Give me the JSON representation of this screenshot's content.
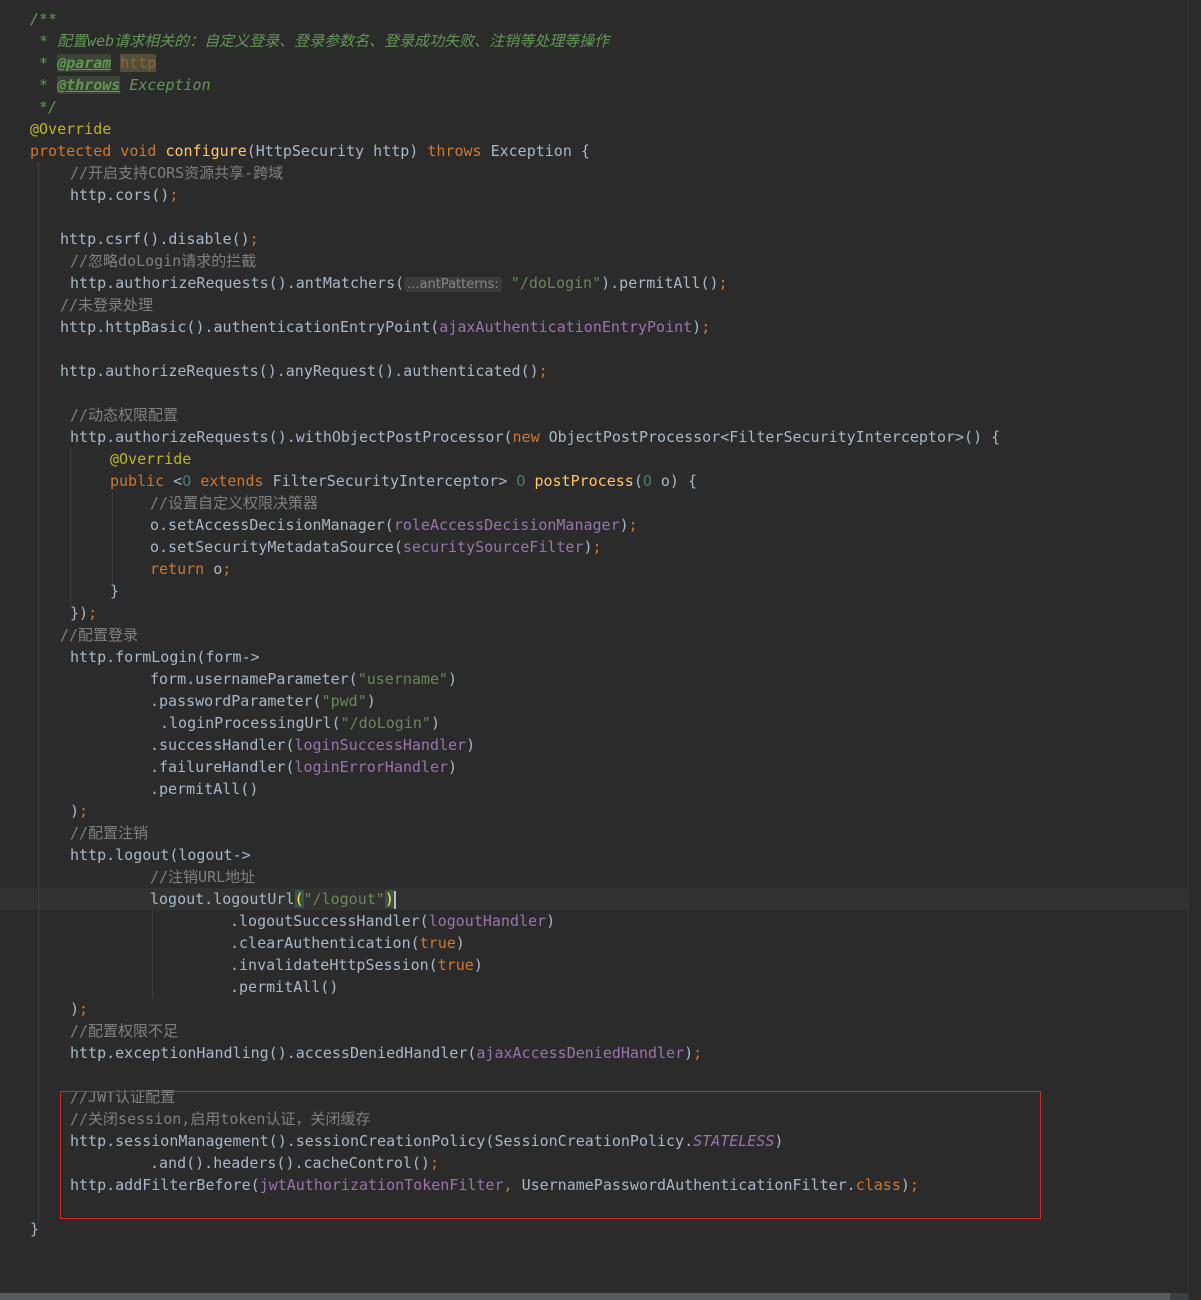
{
  "editor": {
    "language": "java",
    "lines": [
      {
        "indent": 30,
        "tokens": [
          {
            "t": "/**",
            "c": "doc"
          }
        ]
      },
      {
        "indent": 30,
        "tokens": [
          {
            "t": " * 配置web请求相关的：自定义登录、登录参数名、登录成功失败、注销等处理等操作",
            "c": "doc"
          }
        ]
      },
      {
        "indent": 30,
        "tokens": [
          {
            "t": " * ",
            "c": "doc"
          },
          {
            "t": "@param",
            "c": "doctag"
          },
          {
            "t": " ",
            "c": "doc"
          },
          {
            "t": "http",
            "c": "docparam"
          }
        ]
      },
      {
        "indent": 30,
        "tokens": [
          {
            "t": " * ",
            "c": "doc"
          },
          {
            "t": "@throws",
            "c": "doctag"
          },
          {
            "t": " Exception",
            "c": "doc"
          }
        ]
      },
      {
        "indent": 30,
        "tokens": [
          {
            "t": " */",
            "c": "doc"
          }
        ]
      },
      {
        "indent": 30,
        "tokens": [
          {
            "t": "@Override",
            "c": "ann"
          }
        ]
      },
      {
        "indent": 30,
        "tokens": [
          {
            "t": "protected void ",
            "c": "kw"
          },
          {
            "t": "configure",
            "c": "fn"
          },
          {
            "t": "(HttpSecurity http) ",
            "c": "def"
          },
          {
            "t": "throws ",
            "c": "kw"
          },
          {
            "t": "Exception {",
            "c": "def"
          }
        ]
      },
      {
        "indent": 70,
        "tokens": [
          {
            "t": "//开启支持CORS资源共享-跨域",
            "c": "cmt"
          }
        ]
      },
      {
        "indent": 70,
        "tokens": [
          {
            "t": "http.cors()",
            "c": "def"
          },
          {
            "t": ";",
            "c": "kw"
          }
        ]
      },
      {
        "indent": 70,
        "tokens": []
      },
      {
        "indent": 60,
        "tokens": [
          {
            "t": "http.csrf().disable()",
            "c": "def"
          },
          {
            "t": ";",
            "c": "kw"
          }
        ]
      },
      {
        "indent": 70,
        "tokens": [
          {
            "t": "//忽略doLogin请求的拦截",
            "c": "cmt"
          }
        ]
      },
      {
        "indent": 70,
        "tokens": [
          {
            "t": "http.authorizeRequests().antMatchers(",
            "c": "def"
          },
          {
            "t": "...antPatterns:",
            "c": "hint"
          },
          {
            "t": " ",
            "c": "def"
          },
          {
            "t": "\"/doLogin\"",
            "c": "str"
          },
          {
            "t": ").permitAll()",
            "c": "def"
          },
          {
            "t": ";",
            "c": "kw"
          }
        ]
      },
      {
        "indent": 60,
        "tokens": [
          {
            "t": "//未登录处理",
            "c": "cmt"
          }
        ]
      },
      {
        "indent": 60,
        "tokens": [
          {
            "t": "http.httpBasic().authenticationEntryPoint(",
            "c": "def"
          },
          {
            "t": "ajaxAuthenticationEntryPoint",
            "c": "fld"
          },
          {
            "t": ")",
            "c": "def"
          },
          {
            "t": ";",
            "c": "kw"
          }
        ]
      },
      {
        "indent": 60,
        "tokens": []
      },
      {
        "indent": 60,
        "tokens": [
          {
            "t": "http.authorizeRequests().anyRequest().authenticated()",
            "c": "def"
          },
          {
            "t": ";",
            "c": "kw"
          }
        ]
      },
      {
        "indent": 60,
        "tokens": []
      },
      {
        "indent": 70,
        "tokens": [
          {
            "t": "//动态权限配置",
            "c": "cmt"
          }
        ]
      },
      {
        "indent": 70,
        "tokens": [
          {
            "t": "http.authorizeRequests().withObjectPostProcessor(",
            "c": "def"
          },
          {
            "t": "new ",
            "c": "kw"
          },
          {
            "t": "ObjectPostProcessor<FilterSecurityInterceptor>() {",
            "c": "def"
          }
        ]
      },
      {
        "indent": 110,
        "tokens": [
          {
            "t": "@Override",
            "c": "ann"
          }
        ]
      },
      {
        "indent": 110,
        "tokens": [
          {
            "t": "public ",
            "c": "kw"
          },
          {
            "t": "<",
            "c": "def"
          },
          {
            "t": "O ",
            "c": "typp"
          },
          {
            "t": "extends ",
            "c": "kw"
          },
          {
            "t": "FilterSecurityInterceptor> ",
            "c": "def"
          },
          {
            "t": "O ",
            "c": "typp"
          },
          {
            "t": "postProcess",
            "c": "fn"
          },
          {
            "t": "(",
            "c": "def"
          },
          {
            "t": "O ",
            "c": "typp"
          },
          {
            "t": "o) {",
            "c": "def"
          }
        ]
      },
      {
        "indent": 150,
        "tokens": [
          {
            "t": "//设置自定义权限决策器",
            "c": "cmt"
          }
        ]
      },
      {
        "indent": 150,
        "tokens": [
          {
            "t": "o.setAccessDecisionManager(",
            "c": "def"
          },
          {
            "t": "roleAccessDecisionManager",
            "c": "fld"
          },
          {
            "t": ")",
            "c": "def"
          },
          {
            "t": ";",
            "c": "kw"
          }
        ]
      },
      {
        "indent": 150,
        "tokens": [
          {
            "t": "o.setSecurityMetadataSource(",
            "c": "def"
          },
          {
            "t": "securitySourceFilter",
            "c": "fld"
          },
          {
            "t": ")",
            "c": "def"
          },
          {
            "t": ";",
            "c": "kw"
          }
        ]
      },
      {
        "indent": 150,
        "tokens": [
          {
            "t": "return ",
            "c": "kw"
          },
          {
            "t": "o",
            "c": "def"
          },
          {
            "t": ";",
            "c": "kw"
          }
        ]
      },
      {
        "indent": 110,
        "tokens": [
          {
            "t": "}",
            "c": "def"
          }
        ]
      },
      {
        "indent": 70,
        "tokens": [
          {
            "t": "})",
            "c": "def"
          },
          {
            "t": ";",
            "c": "kw"
          }
        ]
      },
      {
        "indent": 60,
        "tokens": [
          {
            "t": "//配置登录",
            "c": "cmt"
          }
        ]
      },
      {
        "indent": 70,
        "tokens": [
          {
            "t": "http.formLogin(form->",
            "c": "def"
          }
        ]
      },
      {
        "indent": 150,
        "tokens": [
          {
            "t": "form.usernameParameter(",
            "c": "def"
          },
          {
            "t": "\"username\"",
            "c": "str"
          },
          {
            "t": ")",
            "c": "def"
          }
        ]
      },
      {
        "indent": 150,
        "tokens": [
          {
            "t": ".passwordParameter(",
            "c": "def"
          },
          {
            "t": "\"pwd\"",
            "c": "str"
          },
          {
            "t": ")",
            "c": "def"
          }
        ]
      },
      {
        "indent": 160,
        "tokens": [
          {
            "t": ".loginProcessingUrl(",
            "c": "def"
          },
          {
            "t": "\"/doLogin\"",
            "c": "str"
          },
          {
            "t": ")",
            "c": "def"
          }
        ]
      },
      {
        "indent": 150,
        "tokens": [
          {
            "t": ".successHandler(",
            "c": "def"
          },
          {
            "t": "loginSuccessHandler",
            "c": "fld"
          },
          {
            "t": ")",
            "c": "def"
          }
        ]
      },
      {
        "indent": 150,
        "tokens": [
          {
            "t": ".failureHandler(",
            "c": "def"
          },
          {
            "t": "loginErrorHandler",
            "c": "fld"
          },
          {
            "t": ")",
            "c": "def"
          }
        ]
      },
      {
        "indent": 150,
        "tokens": [
          {
            "t": ".permitAll()",
            "c": "def"
          }
        ]
      },
      {
        "indent": 70,
        "tokens": [
          {
            "t": ")",
            "c": "def"
          },
          {
            "t": ";",
            "c": "kw"
          }
        ]
      },
      {
        "indent": 70,
        "tokens": [
          {
            "t": "//配置注销",
            "c": "cmt"
          }
        ]
      },
      {
        "indent": 70,
        "tokens": [
          {
            "t": "http.logout(logout->",
            "c": "def"
          }
        ]
      },
      {
        "indent": 150,
        "tokens": [
          {
            "t": "//注销URL地址",
            "c": "cmt"
          }
        ]
      },
      {
        "indent": 150,
        "current": true,
        "tokens": [
          {
            "t": "logout.logoutUrl",
            "c": "def"
          },
          {
            "t": "(",
            "c": "brk"
          },
          {
            "t": "\"/logout\"",
            "c": "str"
          },
          {
            "t": ")",
            "c": "brk"
          },
          {
            "t": "",
            "c": "caret"
          }
        ]
      },
      {
        "indent": 230,
        "tokens": [
          {
            "t": ".logoutSuccessHandler(",
            "c": "def"
          },
          {
            "t": "logoutHandler",
            "c": "fld"
          },
          {
            "t": ")",
            "c": "def"
          }
        ]
      },
      {
        "indent": 230,
        "tokens": [
          {
            "t": ".clearAuthentication(",
            "c": "def"
          },
          {
            "t": "true",
            "c": "kw"
          },
          {
            "t": ")",
            "c": "def"
          }
        ]
      },
      {
        "indent": 230,
        "tokens": [
          {
            "t": ".invalidateHttpSession(",
            "c": "def"
          },
          {
            "t": "true",
            "c": "kw"
          },
          {
            "t": ")",
            "c": "def"
          }
        ]
      },
      {
        "indent": 230,
        "tokens": [
          {
            "t": ".permitAll()",
            "c": "def"
          }
        ]
      },
      {
        "indent": 70,
        "tokens": [
          {
            "t": ")",
            "c": "def"
          },
          {
            "t": ";",
            "c": "kw"
          }
        ]
      },
      {
        "indent": 70,
        "tokens": [
          {
            "t": "//配置权限不足",
            "c": "cmt"
          }
        ]
      },
      {
        "indent": 70,
        "tokens": [
          {
            "t": "http.exceptionHandling().accessDeniedHandler(",
            "c": "def"
          },
          {
            "t": "ajaxAccessDeniedHandler",
            "c": "fld"
          },
          {
            "t": ")",
            "c": "def"
          },
          {
            "t": ";",
            "c": "kw"
          }
        ]
      },
      {
        "indent": 70,
        "tokens": []
      },
      {
        "indent": 70,
        "tokens": [
          {
            "t": "//JWT认证配置",
            "c": "cmt"
          }
        ]
      },
      {
        "indent": 70,
        "tokens": [
          {
            "t": "//关闭session,启用token认证，关闭缓存",
            "c": "cmt"
          }
        ]
      },
      {
        "indent": 70,
        "tokens": [
          {
            "t": "http.sessionManagement().sessionCreationPolicy(SessionCreationPolicy.",
            "c": "def"
          },
          {
            "t": "STATELESS",
            "c": "static"
          },
          {
            "t": ")",
            "c": "def"
          }
        ]
      },
      {
        "indent": 150,
        "tokens": [
          {
            "t": ".and().headers().cacheControl()",
            "c": "def"
          },
          {
            "t": ";",
            "c": "kw"
          }
        ]
      },
      {
        "indent": 70,
        "tokens": [
          {
            "t": "http.addFilterBefore(",
            "c": "def"
          },
          {
            "t": "jwtAuthorizationTokenFilter",
            "c": "fld"
          },
          {
            "t": ", ",
            "c": "kw"
          },
          {
            "t": "UsernamePasswordAuthenticationFilter.",
            "c": "def"
          },
          {
            "t": "class",
            "c": "kw"
          },
          {
            "t": ")",
            "c": "def"
          },
          {
            "t": ";",
            "c": "kw"
          }
        ]
      },
      {
        "indent": 70,
        "tokens": []
      },
      {
        "indent": 30,
        "tokens": [
          {
            "t": "}",
            "c": "def"
          }
        ]
      }
    ]
  },
  "colors": {
    "background": "#2b2b2b",
    "default_text": "#a9b7c6",
    "keyword": "#cc7832",
    "string": "#6a8759",
    "comment": "#808080",
    "doc_comment": "#629755",
    "annotation": "#bbb529",
    "field": "#9876aa",
    "method_decl": "#ffc66d",
    "highlight_box": "#d3272b"
  }
}
